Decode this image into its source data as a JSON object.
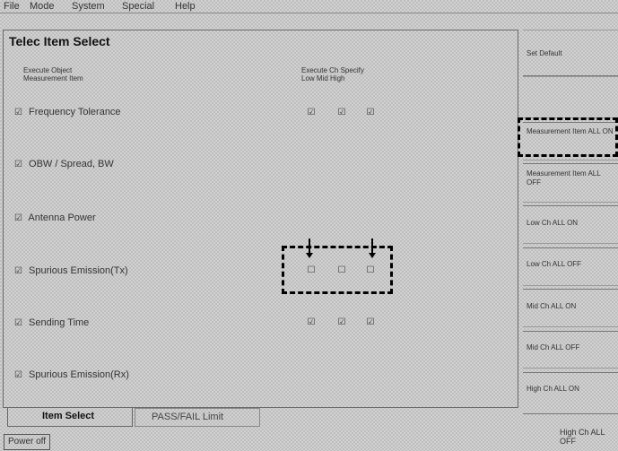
{
  "menu": [
    "File",
    "Mode",
    "System",
    "Special",
    "Help"
  ],
  "panel": {
    "title": "Telec Item Select",
    "hdr_left": [
      "Execute Object",
      "Measurement Item"
    ],
    "hdr_right": [
      "Execute Ch Specify",
      "Low  Mid  High"
    ]
  },
  "items": [
    {
      "label": "Frequency Tolerance",
      "checks": [
        "☑",
        "☑",
        "☑"
      ]
    },
    {
      "label": "OBW / Spread, BW",
      "checks": [
        "",
        "",
        ""
      ]
    },
    {
      "label": "Antenna Power",
      "checks": [
        "",
        "",
        ""
      ]
    },
    {
      "label": "Spurious Emission(Tx)",
      "checks": [
        "☐",
        "☐",
        "☐"
      ]
    },
    {
      "label": "Sending Time",
      "checks": [
        "☑",
        "☑",
        "☑"
      ]
    },
    {
      "label": "Spurious Emission(Rx)",
      "checks": [
        "",
        "",
        ""
      ]
    }
  ],
  "softkeys": [
    "Set Default",
    "",
    "Measurement Item ALL ON",
    "Measurement Item ALL OFF",
    "Low Ch ALL ON",
    "Low Ch ALL OFF",
    "Mid Ch ALL ON",
    "Mid Ch ALL OFF",
    "High Ch ALL ON"
  ],
  "tabs": {
    "active": "Item Select",
    "inactive": "PASS/FAIL Limit"
  },
  "footer": {
    "power": "Power off",
    "right": "High Ch ALL OFF"
  },
  "check_glyph": "☑"
}
